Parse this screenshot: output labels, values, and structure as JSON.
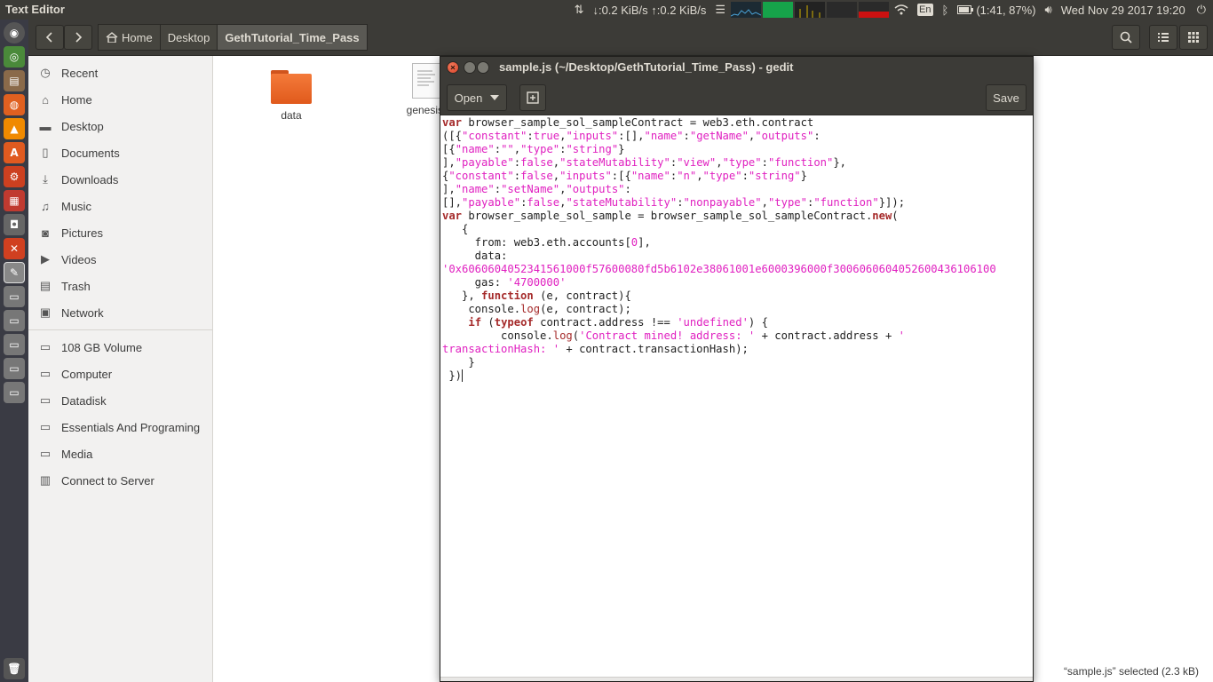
{
  "top_panel": {
    "app_title": "Text Editor",
    "net_down": "↓:0.2 KiB/s",
    "net_up": "↑:0.2 KiB/s",
    "language": "En",
    "battery": "(1:41, 87%)",
    "datetime": "Wed Nov 29 2017 19:20"
  },
  "files": {
    "breadcrumbs": [
      "Home",
      "Desktop",
      "GethTutorial_Time_Pass"
    ],
    "sidebar": {
      "places": [
        {
          "label": "Recent",
          "icon": "clock-icon"
        },
        {
          "label": "Home",
          "icon": "home-icon"
        },
        {
          "label": "Desktop",
          "icon": "folder-icon"
        },
        {
          "label": "Documents",
          "icon": "document-icon"
        },
        {
          "label": "Downloads",
          "icon": "download-icon"
        },
        {
          "label": "Music",
          "icon": "music-icon"
        },
        {
          "label": "Pictures",
          "icon": "camera-icon"
        },
        {
          "label": "Videos",
          "icon": "video-icon"
        },
        {
          "label": "Trash",
          "icon": "trash-icon"
        },
        {
          "label": "Network",
          "icon": "network-icon"
        }
      ],
      "devices": [
        {
          "label": "108 GB Volume",
          "icon": "drive-icon"
        },
        {
          "label": "Computer",
          "icon": "drive-icon"
        },
        {
          "label": "Datadisk",
          "icon": "drive-icon"
        },
        {
          "label": "Essentials And Programing",
          "icon": "drive-icon"
        },
        {
          "label": "Media",
          "icon": "drive-icon"
        },
        {
          "label": "Connect to Server",
          "icon": "server-icon"
        }
      ]
    },
    "items": [
      {
        "name": "data",
        "type": "folder"
      },
      {
        "name": "genesis.",
        "type": "document"
      }
    ],
    "status": "“sample.js” selected  (2.3 kB)"
  },
  "gedit": {
    "title": "sample.js (~/Desktop/GethTutorial_Time_Pass) - gedit",
    "open_label": "Open",
    "save_label": "Save"
  }
}
